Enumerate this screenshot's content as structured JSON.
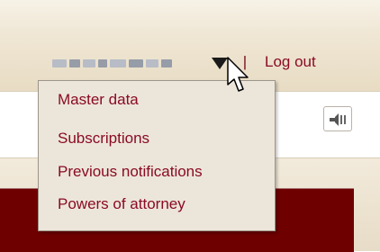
{
  "header": {
    "user_dropdown_icon": "caret-down-icon",
    "separator": "|",
    "logout_label": "Log out"
  },
  "user_menu": {
    "items": [
      {
        "label": "Master data"
      },
      {
        "label": "Subscriptions"
      },
      {
        "label": "Previous notifications"
      },
      {
        "label": "Powers of attorney"
      }
    ]
  },
  "toolbar": {
    "audio_icon": "speaker-icon"
  },
  "colors": {
    "link": "#8a0b24",
    "header_bg": "#efe6d4",
    "menu_bg": "#ece6da",
    "dark_panel": "#6e0000"
  }
}
